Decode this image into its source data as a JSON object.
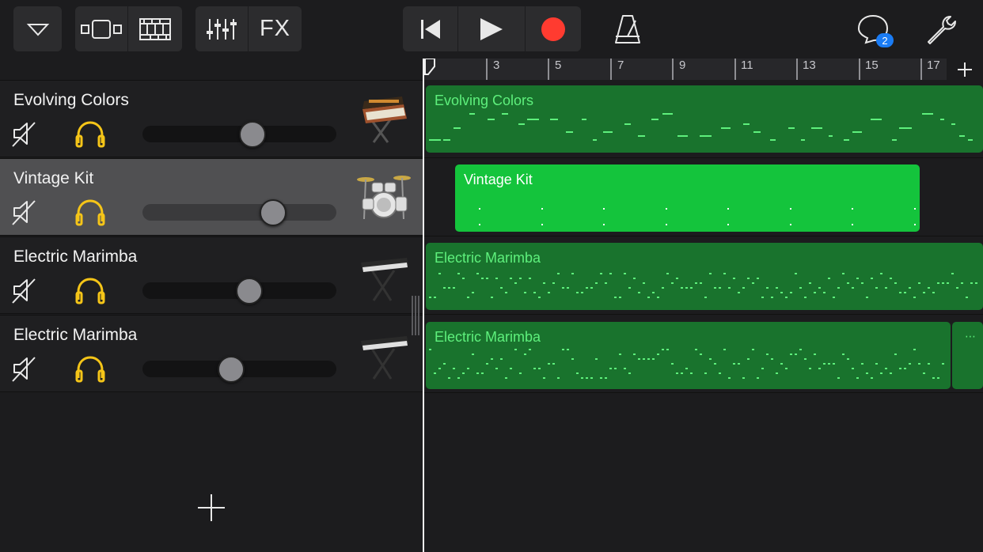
{
  "toolbar": {
    "left_buttons": [
      {
        "name": "browser-button",
        "icon": "triangle-down-icon"
      },
      {
        "name": "tracks-view-button",
        "icon": "tracks-view-icon"
      },
      {
        "name": "song-sections-button",
        "icon": "film-strip-icon"
      },
      {
        "name": "mixer-button",
        "icon": "faders-icon"
      },
      {
        "name": "fx-button",
        "label": "FX"
      }
    ],
    "transport": [
      {
        "name": "go-to-beginning-button",
        "icon": "skip-back-icon"
      },
      {
        "name": "play-button",
        "icon": "play-icon"
      },
      {
        "name": "record-button",
        "icon": "record-icon"
      }
    ],
    "metronome": {
      "icon": "metronome-icon"
    },
    "loops": {
      "icon": "loop-browser-icon",
      "badge": "2"
    },
    "settings": {
      "icon": "wrench-icon"
    },
    "colors": {
      "record": "#ff3b30",
      "badge": "#1a7cf5",
      "solo": "#f5c518"
    }
  },
  "ruler": {
    "bars": [
      "3",
      "5",
      "7",
      "9",
      "11",
      "13",
      "15",
      "17"
    ],
    "add_icon": "plus-icon"
  },
  "tracks": [
    {
      "name": "Evolving Colors",
      "instrument": "vintage-synth-icon",
      "volume": 0.58,
      "selected": false,
      "muted": false,
      "solo": false
    },
    {
      "name": "Vintage Kit",
      "instrument": "drum-kit-icon",
      "volume": 0.7,
      "selected": true,
      "muted": false,
      "solo": false
    },
    {
      "name": "Electric Marimba",
      "instrument": "keyboard-stand-icon",
      "volume": 0.56,
      "selected": false,
      "muted": false,
      "solo": false
    },
    {
      "name": "Electric Marimba",
      "instrument": "keyboard-stand-icon",
      "volume": 0.45,
      "selected": false,
      "muted": false,
      "solo": false
    }
  ],
  "regions": [
    {
      "track": 0,
      "name": "Evolving Colors",
      "selected": false
    },
    {
      "track": 1,
      "name": "Vintage Kit",
      "selected": true
    },
    {
      "track": 2,
      "name": "Electric Marimba",
      "selected": false
    },
    {
      "track": 3,
      "name": "Electric Marimba",
      "selected": false
    },
    {
      "track": 3,
      "name": "",
      "selected": false
    }
  ],
  "add_track_icon": "plus-icon",
  "region_colors": {
    "region": "#19732d",
    "selected_region": "#14c43c",
    "notes": "#5ef07c"
  }
}
